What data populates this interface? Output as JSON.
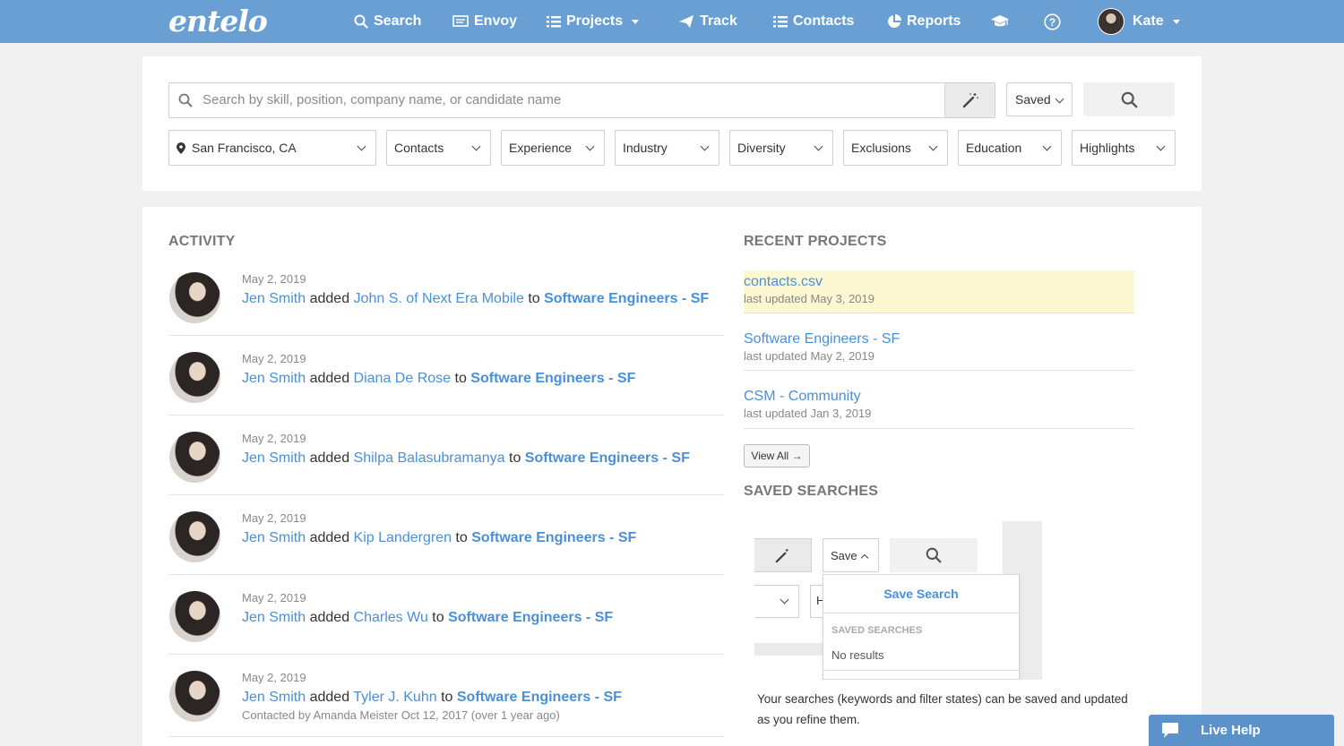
{
  "nav": {
    "logo": "entelo",
    "items": [
      {
        "label": "Search"
      },
      {
        "label": "Envoy"
      },
      {
        "label": "Projects"
      },
      {
        "label": "Track"
      },
      {
        "label": "Contacts"
      },
      {
        "label": "Reports"
      }
    ],
    "user_name": "Kate",
    "icons": [
      "search-icon",
      "envoy-icon",
      "list-icon",
      "paper-plane-icon",
      "list-icon",
      "pie-chart-icon",
      "graduation-cap-icon",
      "help-icon"
    ]
  },
  "search": {
    "placeholder": "Search by skill, position, company name, or candidate name",
    "saved_label": "Saved",
    "filters": {
      "location": "San Francisco, CA",
      "contacts": "Contacts",
      "experience": "Experience",
      "industry": "Industry",
      "diversity": "Diversity",
      "exclusions": "Exclusions",
      "education": "Education",
      "highlights": "Highlights"
    }
  },
  "activity": {
    "title": "ACTIVITY",
    "items": [
      {
        "date": "May 2, 2019",
        "actor": "Jen Smith",
        "verb": "added",
        "candidate": "John S. of Next Era Mobile",
        "prep": "to",
        "project": "Software Engineers - SF"
      },
      {
        "date": "May 2, 2019",
        "actor": "Jen Smith",
        "verb": "added",
        "candidate": "Diana De Rose",
        "prep": "to",
        "project": "Software Engineers - SF"
      },
      {
        "date": "May 2, 2019",
        "actor": "Jen Smith",
        "verb": "added",
        "candidate": "Shilpa Balasubramanya",
        "prep": "to",
        "project": "Software Engineers - SF"
      },
      {
        "date": "May 2, 2019",
        "actor": "Jen Smith",
        "verb": "added",
        "candidate": "Kip Landergren",
        "prep": "to",
        "project": "Software Engineers - SF"
      },
      {
        "date": "May 2, 2019",
        "actor": "Jen Smith",
        "verb": "added",
        "candidate": "Charles Wu",
        "prep": "to",
        "project": "Software Engineers - SF"
      },
      {
        "date": "May 2, 2019",
        "actor": "Jen Smith",
        "verb": "added",
        "candidate": "Tyler J. Kuhn",
        "prep": "to",
        "project": "Software Engineers - SF",
        "note": "Contacted by Amanda Meister Oct 12, 2017 (over 1 year ago)"
      }
    ]
  },
  "recent_projects": {
    "title": "RECENT PROJECTS",
    "items": [
      {
        "name": "contacts.csv",
        "updated": "last updated May 3, 2019"
      },
      {
        "name": "Software Engineers - SF",
        "updated": "last updated May 2, 2019"
      },
      {
        "name": "CSM - Community",
        "updated": "last updated Jan 3, 2019"
      }
    ],
    "view_all": "View All →"
  },
  "saved_searches": {
    "title": "SAVED SEARCHES",
    "illus": {
      "save_label": "Save",
      "save_search_btn": "Save Search",
      "section_label": "SAVED SEARCHES",
      "no_results": "No results",
      "cut_filter_letter": "H"
    },
    "description": "Your searches (keywords and filter states) can be saved and updated as you refine them."
  },
  "live_help": "Live Help",
  "colors": {
    "nav_bg": "#6a9fd4",
    "link": "#4a90d9",
    "highlight": "#fdf8d2",
    "live_help_bg": "#5b92c9"
  }
}
